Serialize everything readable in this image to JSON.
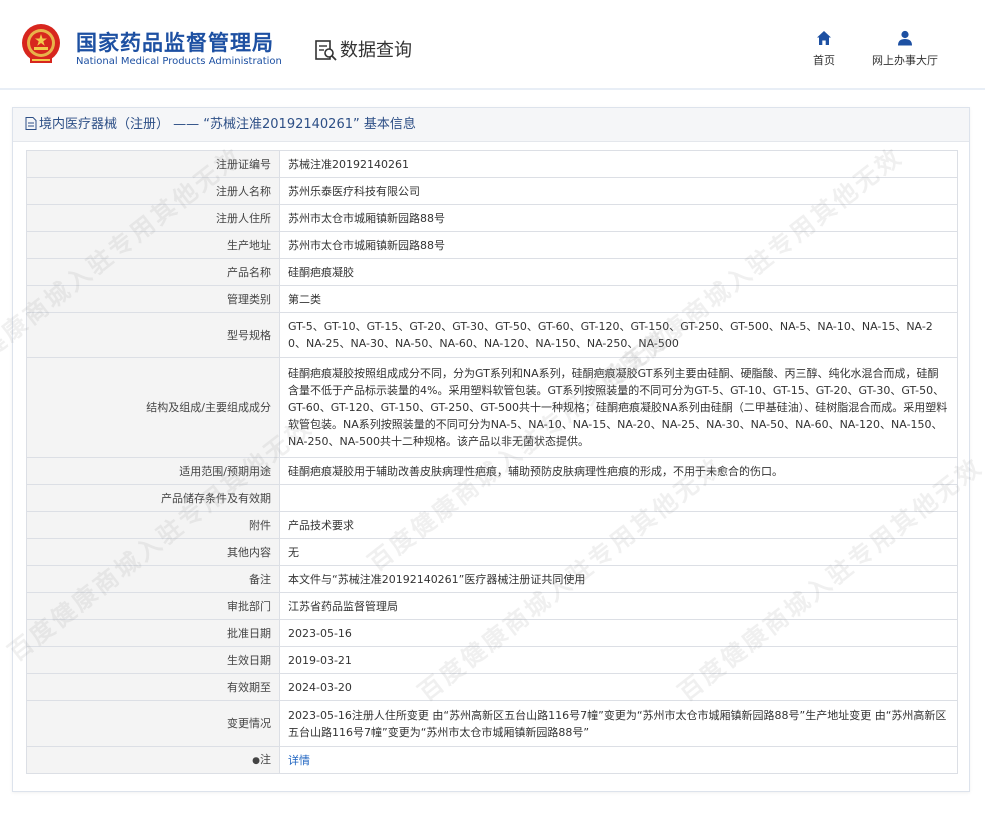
{
  "header": {
    "org_cn": "国家药品监督管理局",
    "org_en": "National Medical Products Administration",
    "query_title": "数据查询",
    "nav": [
      {
        "label": "首页",
        "icon": "home-icon"
      },
      {
        "label": "网上办事大厅",
        "icon": "user-icon"
      }
    ],
    "brand_color": "#1d50a2"
  },
  "panel": {
    "title": "境内医疗器械（注册） —— “苏械注准20192140261” 基本信息"
  },
  "table": {
    "rows": [
      {
        "key": "注册证编号",
        "value": "苏械注准20192140261"
      },
      {
        "key": "注册人名称",
        "value": "苏州乐泰医疗科技有限公司"
      },
      {
        "key": "注册人住所",
        "value": "苏州市太仓市城厢镇新园路88号"
      },
      {
        "key": "生产地址",
        "value": "苏州市太仓市城厢镇新园路88号"
      },
      {
        "key": "产品名称",
        "value": "硅酮疤痕凝胶"
      },
      {
        "key": "管理类别",
        "value": "第二类"
      },
      {
        "key": "型号规格",
        "value": "GT-5、GT-10、GT-15、GT-20、GT-30、GT-50、GT-60、GT-120、GT-150、GT-250、GT-500、NA-5、NA-10、NA-15、NA-20、NA-25、NA-30、NA-50、NA-60、NA-120、NA-150、NA-250、NA-500"
      },
      {
        "key": "结构及组成/主要组成成分",
        "value": "硅酮疤痕凝胶按照组成成分不同，分为GT系列和NA系列，硅酮疤痕凝胶GT系列主要由硅酮、硬脂酸、丙三醇、纯化水混合而成，硅酮含量不低于产品标示装量的4%。采用塑料软管包装。GT系列按照装量的不同可分为GT-5、GT-10、GT-15、GT-20、GT-30、GT-50、GT-60、GT-120、GT-150、GT-250、GT-500共十一种规格；硅酮疤痕凝胶NA系列由硅酮（二甲基硅油）、硅树脂混合而成。采用塑料软管包装。NA系列按照装量的不同可分为NA-5、NA-10、NA-15、NA-20、NA-25、NA-30、NA-50、NA-60、NA-120、NA-150、NA-250、NA-500共十二种规格。该产品以非无菌状态提供。"
      },
      {
        "key": "适用范围/预期用途",
        "value": "硅酮疤痕凝胶用于辅助改善皮肤病理性疤痕，辅助预防皮肤病理性疤痕的形成，不用于未愈合的伤口。"
      },
      {
        "key": "产品储存条件及有效期",
        "value": ""
      },
      {
        "key": "附件",
        "value": "产品技术要求"
      },
      {
        "key": "其他内容",
        "value": "无"
      },
      {
        "key": "备注",
        "value": "本文件与“苏械注准20192140261”医疗器械注册证共同使用"
      },
      {
        "key": "审批部门",
        "value": "江苏省药品监督管理局"
      },
      {
        "key": "批准日期",
        "value": "2023-05-16"
      },
      {
        "key": "生效日期",
        "value": "2019-03-21"
      },
      {
        "key": "有效期至",
        "value": "2024-03-20"
      },
      {
        "key": "变更情况",
        "value": "2023-05-16注册人住所变更 由“苏州高新区五台山路116号7幢”变更为“苏州市太仓市城厢镇新园路88号”生产地址变更 由“苏州高新区五台山路116号7幢”变更为“苏州市太仓市城厢镇新园路88号”"
      }
    ],
    "note": {
      "key": "注",
      "link": "详情"
    }
  },
  "watermark": "百度健康商城入驻专用其他无效"
}
